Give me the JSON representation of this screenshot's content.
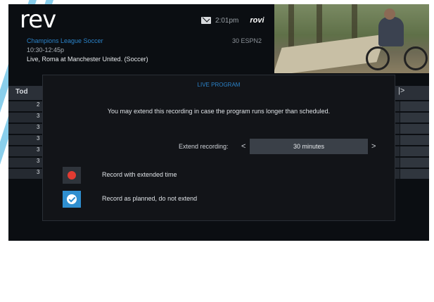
{
  "app": {
    "logo": "rev"
  },
  "status": {
    "time": "2:01pm",
    "brand": "rovi"
  },
  "program": {
    "title": "Champions League Soccer",
    "time": "10:30-12:45p",
    "description": "Live, Roma at Manchester United. (Soccer)",
    "channel": "30 ESPN2"
  },
  "guide": {
    "today": "Tod",
    "next_arrow": "|>",
    "rows": [
      {
        "label": "2"
      },
      {
        "label": "3"
      },
      {
        "label": "3"
      },
      {
        "label": "3"
      },
      {
        "label": "3"
      },
      {
        "label": "3"
      },
      {
        "label": "3"
      }
    ]
  },
  "dialog": {
    "title": "LIVE PROGRAM",
    "message": "You may extend this recording in case the program runs longer than scheduled.",
    "extend_label": "Extend recording:",
    "prev_arrow": "<",
    "extend_value": "30 minutes",
    "next_arrow": ">",
    "options": [
      {
        "label": "Record with extended time",
        "icon": "record-dot-icon",
        "selected": false
      },
      {
        "label": "Record as planned, do not extend",
        "icon": "check-icon",
        "selected": true
      }
    ]
  },
  "colors": {
    "accent": "#2b83c9",
    "record_red": "#e23b32",
    "selected_blue": "#2f8fd0",
    "background": "#0b0e12"
  }
}
